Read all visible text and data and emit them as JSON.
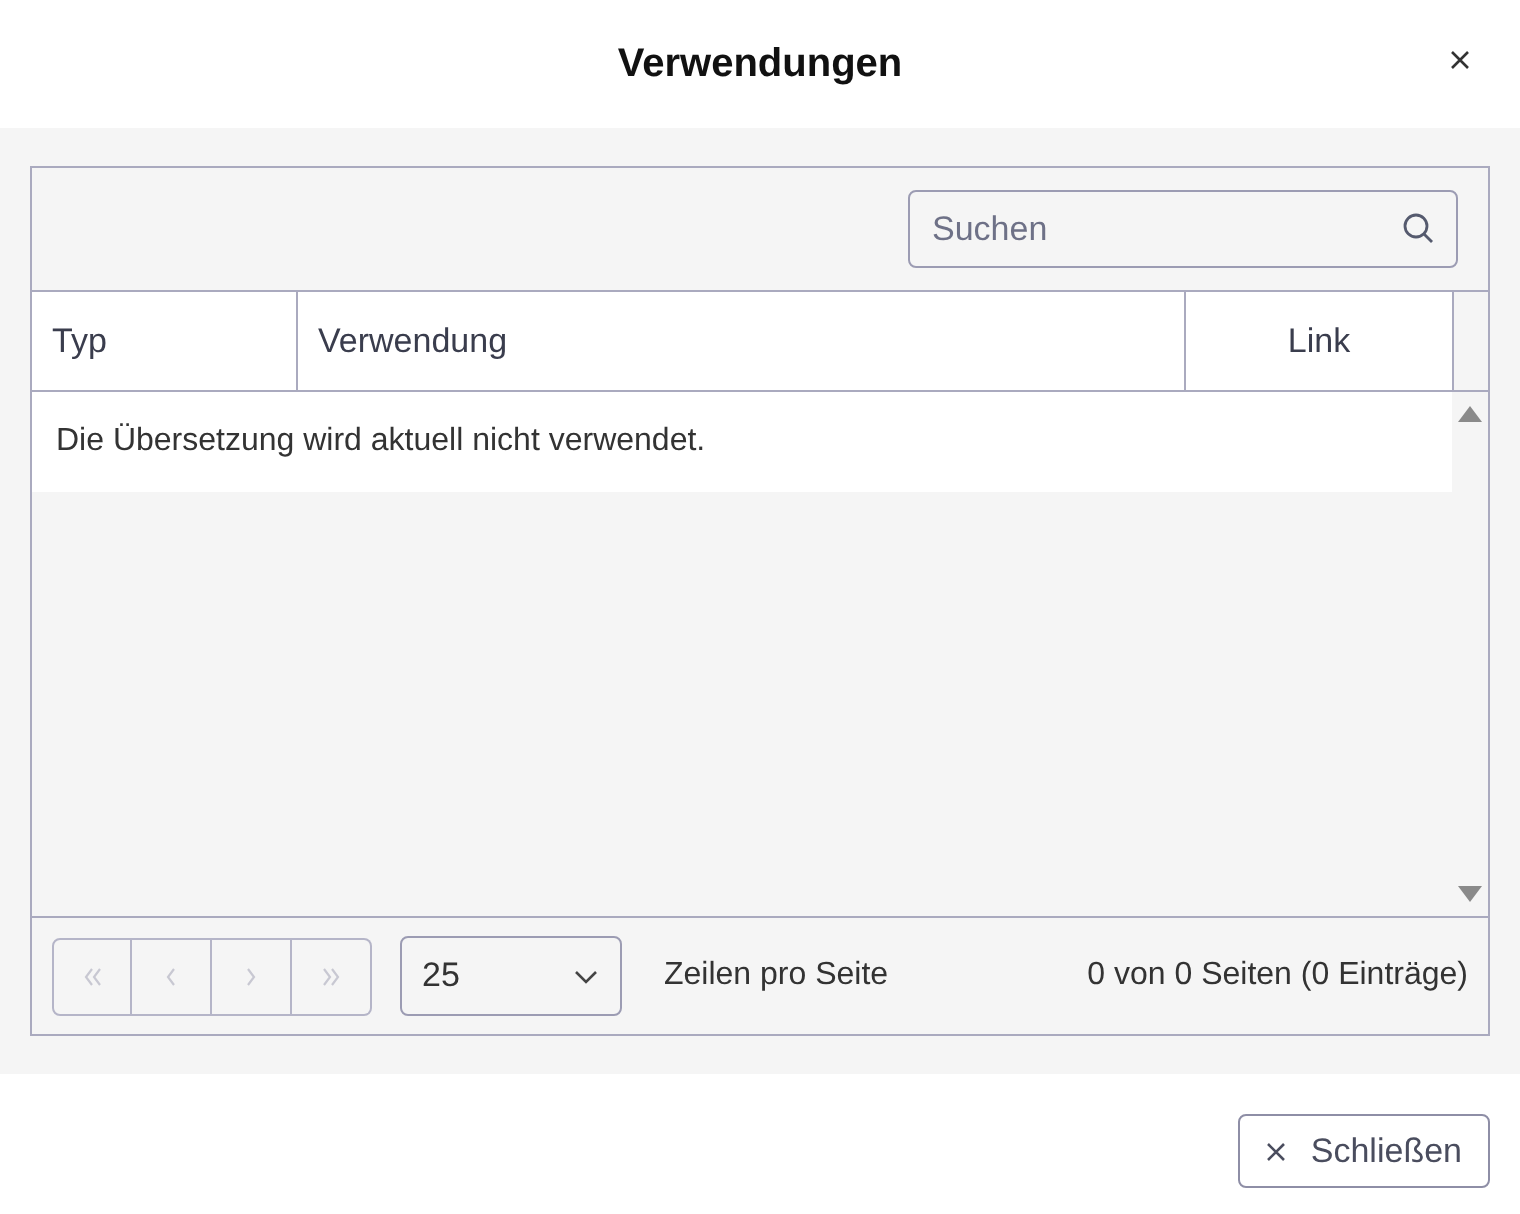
{
  "dialog": {
    "title": "Verwendungen"
  },
  "search": {
    "placeholder": "Suchen"
  },
  "table": {
    "columns": [
      {
        "label": "Typ"
      },
      {
        "label": "Verwendung"
      },
      {
        "label": "Link"
      }
    ],
    "empty_message": "Die Übersetzung wird aktuell nicht verwendet."
  },
  "pager": {
    "buttons": [
      {
        "kind": "first",
        "disabled": true
      },
      {
        "kind": "previous",
        "disabled": true
      },
      {
        "kind": "next",
        "disabled": true
      },
      {
        "kind": "last",
        "disabled": true
      }
    ],
    "page_size": "25",
    "page_size_label": "Zeilen pro Seite",
    "summary": "0 von 0 Seiten (0 Einträge)"
  },
  "footer_buttons": [
    {
      "label": "Schließen"
    }
  ]
}
